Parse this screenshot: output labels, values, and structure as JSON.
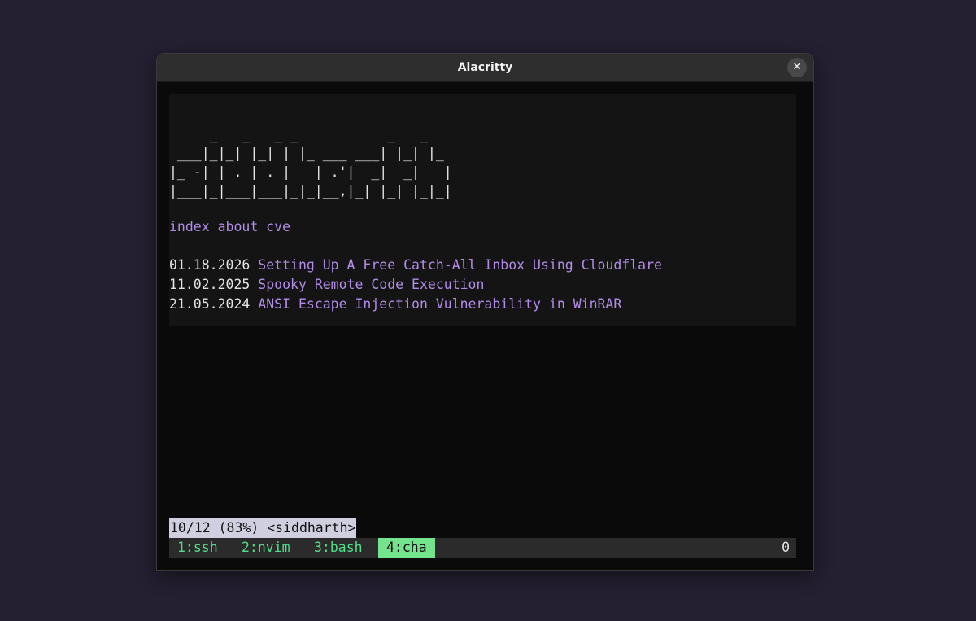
{
  "window": {
    "title": "Alacritty",
    "close_icon": "✕"
  },
  "page": {
    "ascii_art": "     _   _   _ _           _   _\n ___|_|_| |_| | |_ ___ ___| |_| |_\n|_ -| | . | . |   | .'|  _|  _|   |\n|___|_|___|___|_|_|__,|_| |_| |_|_|",
    "nav": [
      {
        "label": "index"
      },
      {
        "label": "about"
      },
      {
        "label": "cve"
      }
    ],
    "posts": [
      {
        "date": "01.18.2026",
        "title": "Setting Up A Free Catch-All Inbox Using Cloudflare"
      },
      {
        "date": "11.02.2025",
        "title": "Spooky Remote Code Execution"
      },
      {
        "date": "21.05.2024",
        "title": "ANSI Escape Injection Vulnerability in WinRAR"
      }
    ]
  },
  "pager": {
    "status": "10/12 (83%) <siddharth>"
  },
  "tmux": {
    "windows": [
      {
        "label": "1:ssh",
        "active": false
      },
      {
        "label": "2:nvim",
        "active": false
      },
      {
        "label": "3:bash",
        "active": false
      },
      {
        "label": "4:cha",
        "active": true
      }
    ],
    "right": "0"
  },
  "colors": {
    "desktop": "#241f31",
    "link": "#b28de8",
    "tmux_tab": "#50e08a",
    "tmux_active_bg": "#74e38d",
    "pager_bg": "#cfcfe0"
  }
}
